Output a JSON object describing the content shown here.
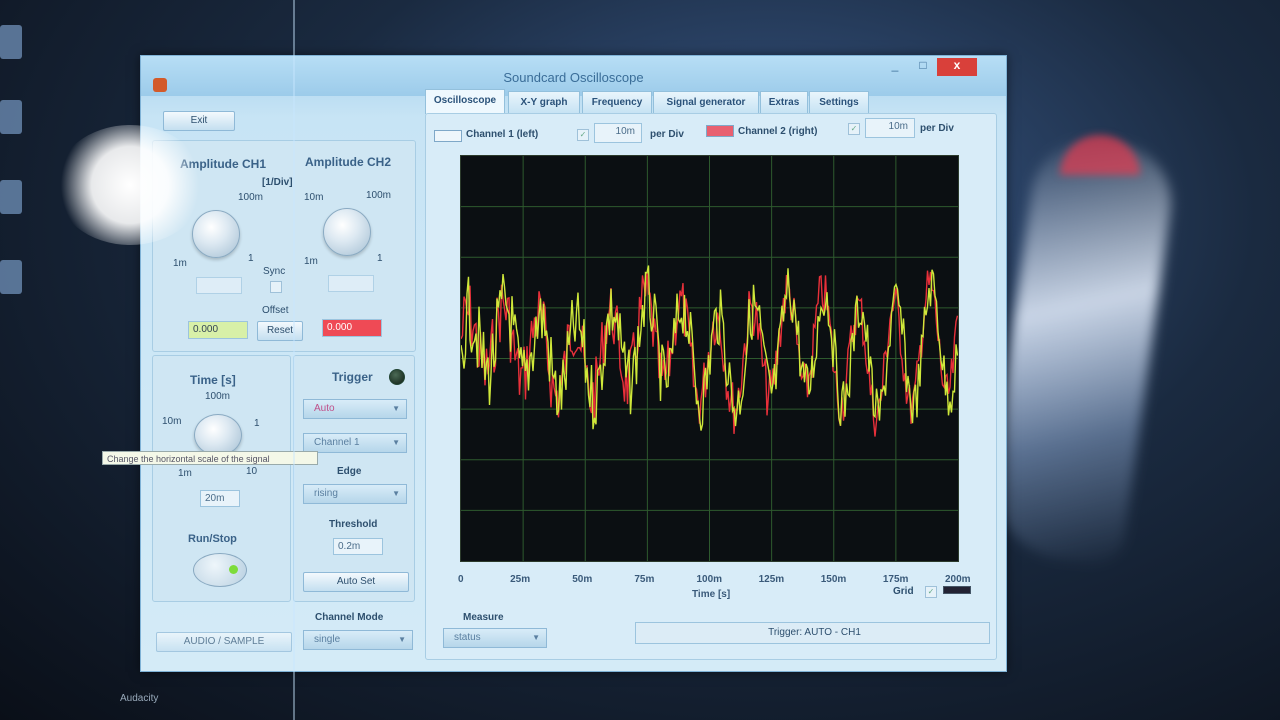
{
  "window": {
    "title": "Soundcard Oscilloscope",
    "min": "_",
    "max": "□",
    "close": "x"
  },
  "exit_label": "Exit",
  "ch1": {
    "title": "Amplitude CH1",
    "units": "[1/Div]",
    "scale_top": "100m",
    "scale_left": "1m",
    "scale_right": "1",
    "offset_value": "0.000"
  },
  "ch2": {
    "title": "Amplitude CH2",
    "scale_top_left": "10m",
    "scale_top_right": "100m",
    "scale_left": "1m",
    "scale_right": "1",
    "offset_value": "0.000"
  },
  "sync_label": "Sync",
  "offset_label": "Offset",
  "reset_label": "Reset",
  "time": {
    "title": "Time [s]",
    "scale_top": "100m",
    "scale_left": "10m",
    "scale_right": "1",
    "scale_bottom_left": "1m",
    "scale_bottom_right": "10",
    "value": "20m",
    "tooltip": "Change the horizontal scale of the signal"
  },
  "run_stop_label": "Run/Stop",
  "bottom_left_button": "AUDIO / SAMPLE",
  "trigger": {
    "title": "Trigger",
    "mode": "Auto",
    "source": "Channel 1",
    "edge_label": "Edge",
    "edge": "rising",
    "threshold_label": "Threshold",
    "threshold_value": "0.2m",
    "auto_set": "Auto Set"
  },
  "channel_mode": {
    "label": "Channel Mode",
    "value": "single"
  },
  "measure": {
    "label": "Measure",
    "value": "status"
  },
  "status_text": "Trigger: AUTO - CH1",
  "tabs": [
    "Oscilloscope",
    "X-Y graph",
    "Frequency",
    "Signal generator",
    "Extras",
    "Settings"
  ],
  "channel_bar": {
    "ch1_label": "Channel 1 (left)",
    "ch1_per_div": "10m",
    "ch2_label": "Channel 2 (right)",
    "ch2_per_div": "10m",
    "per_div": "per Div"
  },
  "plot": {
    "xlabel": "Time [s]",
    "xticks": [
      "0",
      "25m",
      "50m",
      "75m",
      "100m",
      "125m",
      "150m",
      "175m",
      "200m"
    ],
    "grid_label": "Grid",
    "grid": true
  },
  "desktop": {
    "taskbar_label": "Audacity"
  },
  "colors": {
    "ch1": "#cfe83a",
    "ch2": "#e8303a",
    "grid": "#2e5a2e",
    "screen": "#0b0f12"
  }
}
